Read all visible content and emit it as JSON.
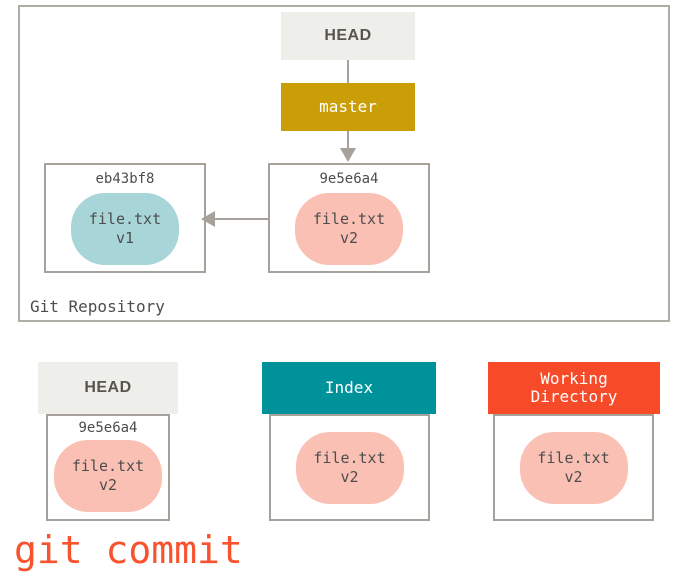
{
  "diagram": {
    "title": "git commit",
    "command_caption": "git commit",
    "repository": {
      "label": "Git Repository",
      "head_label": "HEAD",
      "branch_label": "master",
      "commits": [
        {
          "hash": "eb43bf8",
          "file": "file.txt",
          "version": "v1",
          "blob_color": "#a8d5d8"
        },
        {
          "hash": "9e5e6a4",
          "file": "file.txt",
          "version": "v2",
          "blob_color": "#fac0b4"
        }
      ]
    },
    "areas": [
      {
        "name": "HEAD",
        "header_color": "#eeeeea",
        "header_text_color": "#58544d",
        "hash": "9e5e6a4",
        "file": "file.txt",
        "version": "v2",
        "blob_color": "#fac0b4"
      },
      {
        "name": "Index",
        "header_color": "#00929a",
        "header_text_color": "#ffffff",
        "hash": "",
        "file": "file.txt",
        "version": "v2",
        "blob_color": "#fac0b4"
      },
      {
        "name_line1": "Working",
        "name_line2": "Directory",
        "header_color": "#f74a28",
        "header_text_color": "#ffffff",
        "hash": "",
        "file": "file.txt",
        "version": "v2",
        "blob_color": "#fac0b4"
      }
    ],
    "colors": {
      "branch_bg": "#c99e06",
      "border": "#a6a29b",
      "command_text": "#f7532e",
      "text": "#4d4d4d"
    }
  }
}
